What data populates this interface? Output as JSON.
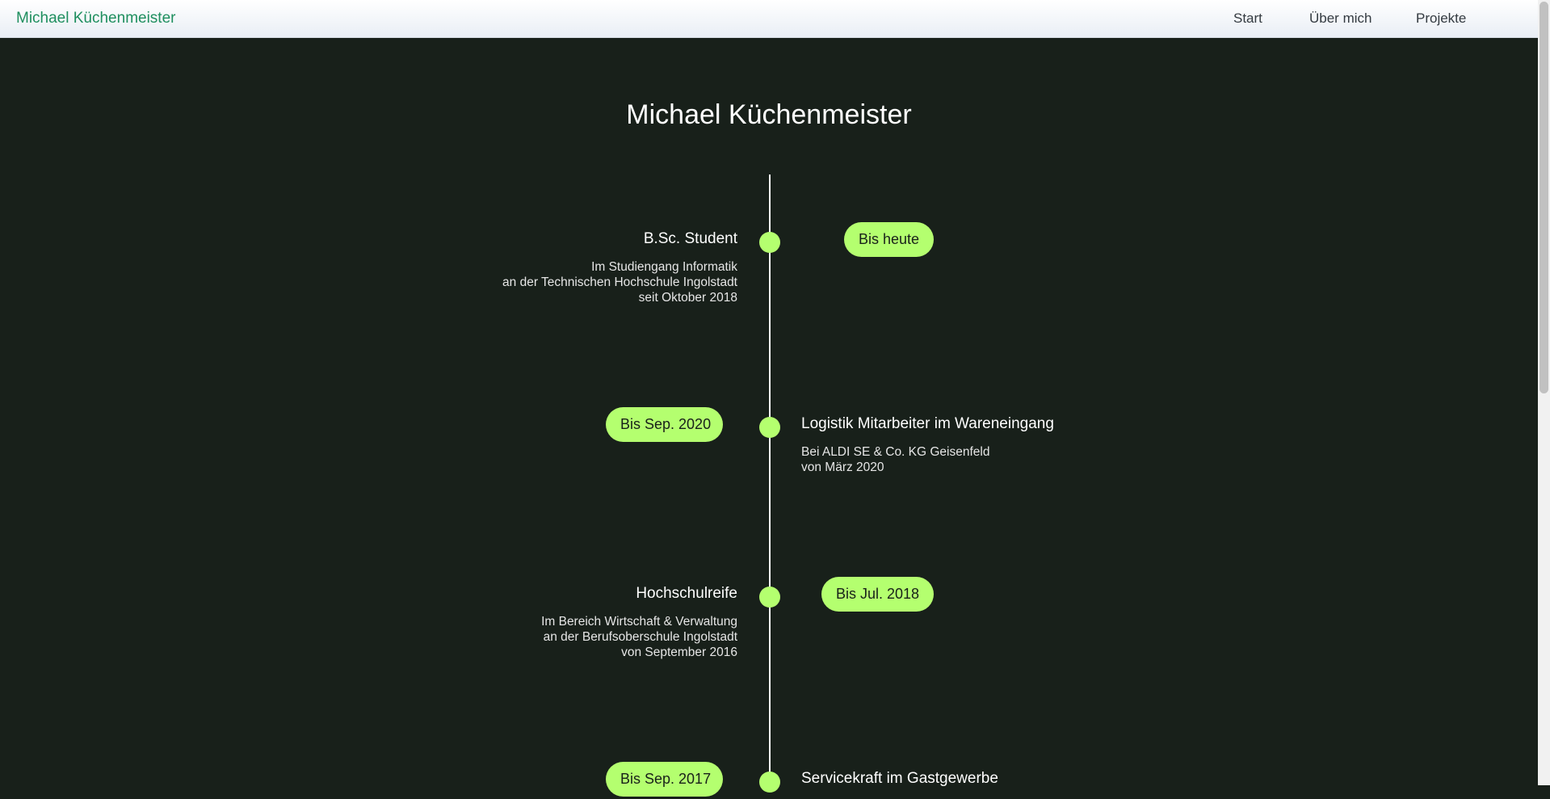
{
  "nav": {
    "brand": "Michael Küchenmeister",
    "links": [
      "Start",
      "Über mich",
      "Projekte"
    ]
  },
  "page": {
    "title": "Michael Küchenmeister"
  },
  "colors": {
    "background": "#18201a",
    "accent": "#b4ff6f",
    "brand": "#1f8f5f"
  },
  "timeline": [
    {
      "title": "B.Sc. Student",
      "desc": [
        "Im Studiengang Informatik",
        "an der Technischen Hochschule Ingolstadt",
        "seit Oktober 2018"
      ],
      "badge": "Bis heute"
    },
    {
      "title": "Logistik Mitarbeiter im Wareneingang",
      "desc": [
        "Bei ALDI SE & Co. KG Geisenfeld",
        "von März 2020"
      ],
      "badge": "Bis Sep. 2020"
    },
    {
      "title": "Hochschulreife",
      "desc": [
        "Im Bereich Wirtschaft & Verwaltung",
        "an der Berufsoberschule Ingolstadt",
        "von September 2016"
      ],
      "badge": "Bis Jul. 2018"
    },
    {
      "title": "Servicekraft im Gastgewerbe",
      "desc": [],
      "badge": "Bis Sep. 2017"
    }
  ]
}
